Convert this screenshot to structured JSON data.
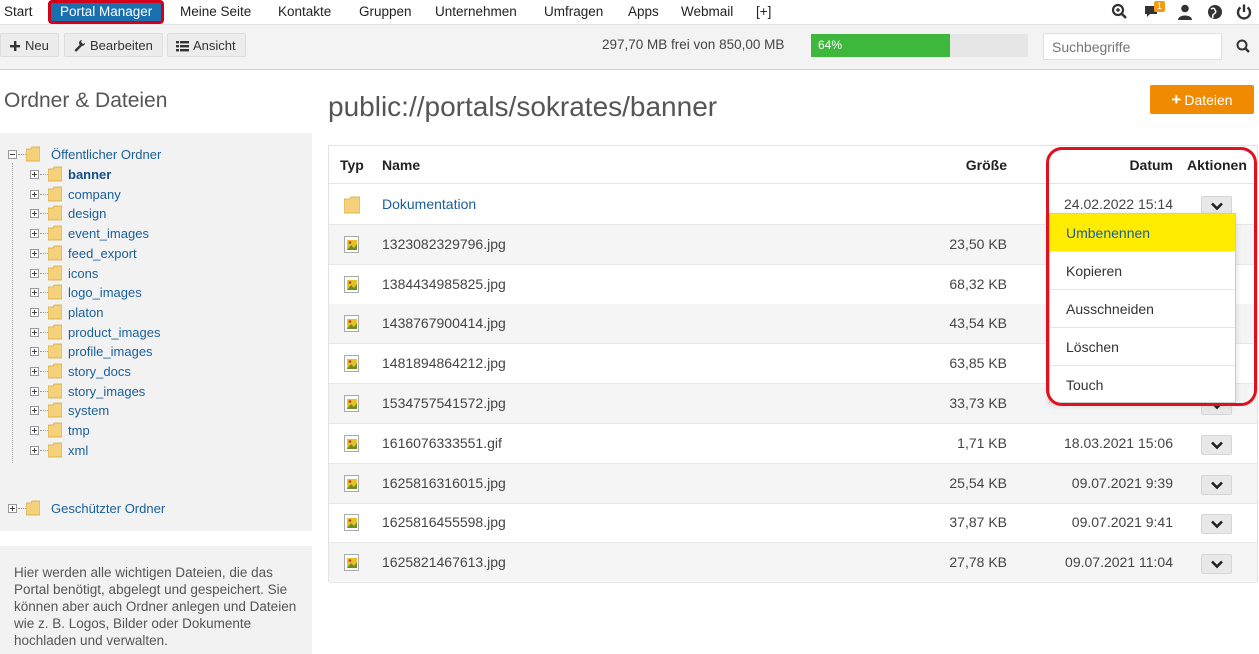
{
  "nav": {
    "items": [
      "Start",
      "Portal Manager",
      "Meine Seite",
      "Kontakte",
      "Gruppen",
      "Unternehmen",
      "Umfragen",
      "Apps",
      "Webmail",
      "[+]"
    ],
    "active": "Portal Manager",
    "messages_badge": "1"
  },
  "toolbar": {
    "new_label": "Neu",
    "edit_label": "Bearbeiten",
    "view_label": "Ansicht",
    "quota_text": "297,70 MB frei von 850,00 MB",
    "usage_percent": 64,
    "usage_label": "64%",
    "search_placeholder": "Suchbegriffe"
  },
  "sidebar": {
    "title": "Ordner & Dateien",
    "public_folder": "Öffentlicher Ordner",
    "folders": [
      "banner",
      "company",
      "design",
      "event_images",
      "feed_export",
      "icons",
      "logo_images",
      "platon",
      "product_images",
      "profile_images",
      "story_docs",
      "story_images",
      "system",
      "tmp",
      "xml"
    ],
    "selected_folder": "banner",
    "protected_folder": "Geschützter Ordner",
    "info_text": "Hier werden alle wichtigen Dateien, die das Portal benötigt, abgelegt und gespeichert. Sie können aber auch Ordner anlegen und Dateien wie z. B. Logos, Bilder oder Dokumente hochladen und verwalten."
  },
  "main": {
    "path": "public://portals/sokrates/banner",
    "add_button": "Dateien",
    "columns": [
      "Typ",
      "Name",
      "Größe",
      "Datum",
      "Aktionen"
    ],
    "rows": [
      {
        "type": "folder",
        "name": "Dokumentation",
        "size": "",
        "date": "24.02.2022 15:14"
      },
      {
        "type": "image",
        "name": "1323082329796.jpg",
        "size": "23,50 KB",
        "date": ""
      },
      {
        "type": "image",
        "name": "1384434985825.jpg",
        "size": "68,32 KB",
        "date": ""
      },
      {
        "type": "image",
        "name": "1438767900414.jpg",
        "size": "43,54 KB",
        "date": ""
      },
      {
        "type": "image",
        "name": "1481894864212.jpg",
        "size": "63,85 KB",
        "date": ""
      },
      {
        "type": "image",
        "name": "1534757541572.jpg",
        "size": "33,73 KB",
        "date": ""
      },
      {
        "type": "image",
        "name": "1616076333551.gif",
        "size": "1,71 KB",
        "date": "18.03.2021 15:06"
      },
      {
        "type": "image",
        "name": "1625816316015.jpg",
        "size": "25,54 KB",
        "date": "09.07.2021 9:39"
      },
      {
        "type": "image",
        "name": "1625816455598.jpg",
        "size": "37,87 KB",
        "date": "09.07.2021 9:41"
      },
      {
        "type": "image",
        "name": "1625821467613.jpg",
        "size": "27,78 KB",
        "date": "09.07.2021 11:04"
      }
    ],
    "actions_menu": [
      "Umbenennen",
      "Kopieren",
      "Ausschneiden",
      "Löschen",
      "Touch"
    ],
    "highlighted_action": "Umbenennen"
  },
  "colors": {
    "nav_active_bg": "#1a6fae",
    "annotation_red": "#e0101e",
    "progress_green": "#3db83d",
    "add_button_orange": "#f08a00",
    "highlight_yellow": "#ffec00",
    "link_blue": "#1a5e9a"
  },
  "icons": {
    "zoom": "zoom-icon",
    "messages": "chat-icon",
    "user": "user-icon",
    "language": "globe-icon",
    "logout": "power-icon",
    "search": "search-icon"
  }
}
